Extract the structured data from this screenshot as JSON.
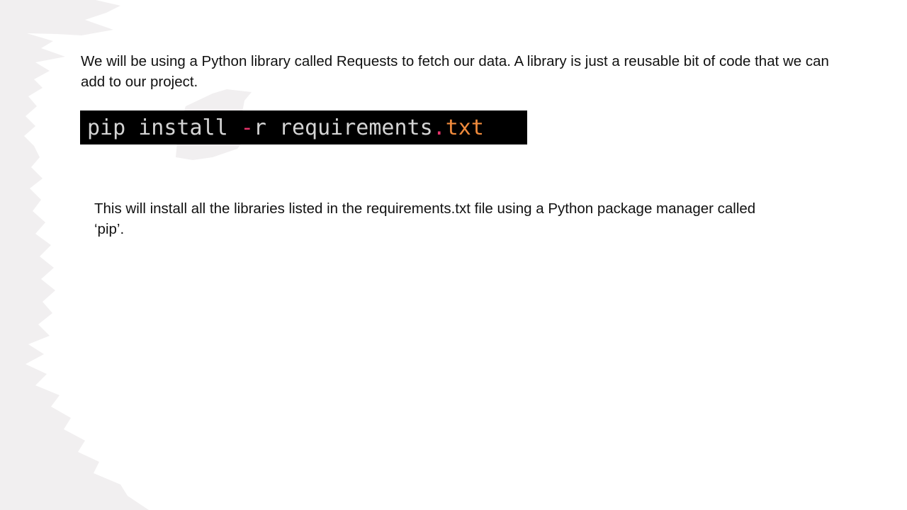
{
  "slide": {
    "intro_text": "We will be using a Python library called Requests to fetch our data. A library is just a reusable bit of code that we can add to our project.",
    "code": {
      "command": "pip install ",
      "flag_dash": "-",
      "flag_letter": "r",
      "space": " ",
      "filename": "requirements",
      "dot": ".",
      "extension": "txt"
    },
    "outro_text": "This will install all the libraries listed in the requirements.txt file using a Python package manager called ‘pip’."
  },
  "colors": {
    "code_background": "#000000",
    "code_text": "#d4d4d4",
    "flag_dash": "#e8336b",
    "dot": "#e8336b",
    "extension": "#ef8a3c",
    "background_splash": "#f1eff0"
  }
}
